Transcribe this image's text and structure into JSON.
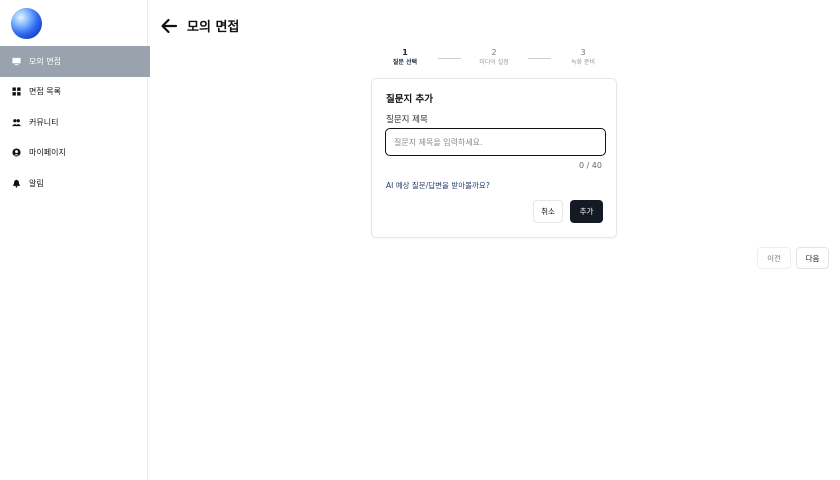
{
  "header": {
    "title": "모의 면접"
  },
  "sidebar": {
    "items": [
      {
        "label": "모의 면접",
        "icon": "monitor-icon",
        "active": true
      },
      {
        "label": "면접 목록",
        "icon": "grid-icon",
        "active": false
      },
      {
        "label": "커뮤니티",
        "icon": "users-icon",
        "active": false
      },
      {
        "label": "마이페이지",
        "icon": "user-circle-icon",
        "active": false
      },
      {
        "label": "알림",
        "icon": "bell-icon",
        "active": false
      }
    ]
  },
  "stepper": {
    "steps": [
      {
        "number": "1",
        "label": "질문 선택",
        "active": true
      },
      {
        "number": "2",
        "label": "미디어 설정",
        "active": false
      },
      {
        "number": "3",
        "label": "녹화 준비",
        "active": false
      }
    ]
  },
  "dialog": {
    "title": "질문지 추가",
    "field_label": "질문지 제목",
    "input_value": "",
    "input_placeholder": "질문지 제목을 입력하세요.",
    "char_count": "0 / 40",
    "ai_prompt": "AI 예상 질문/답변을 받아볼까요?",
    "cancel_label": "취소",
    "add_label": "추가"
  },
  "footer": {
    "prev_label": "이전",
    "next_label": "다음"
  },
  "colors": {
    "active_nav": "#9aa3ad",
    "primary_button": "#141a24",
    "link": "#243a6b"
  }
}
